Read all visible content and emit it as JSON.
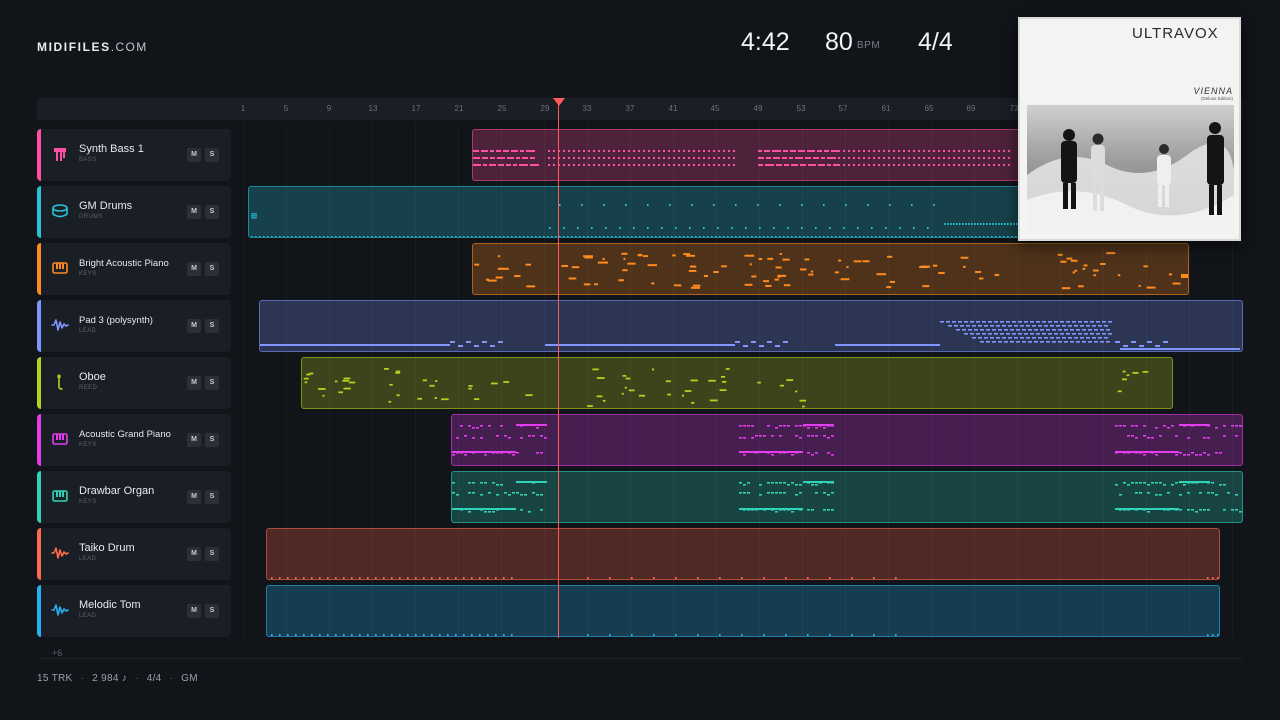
{
  "brand": {
    "name": "MIDIFILES",
    "domain": ".COM"
  },
  "stats": {
    "time": "4:42",
    "bpm": "80",
    "bpm_unit": "BPM",
    "time_signature": "4/4"
  },
  "cover": {
    "band": "ULTRAVOX",
    "album": "VIENNA",
    "edition": "(Deluxe Edition)"
  },
  "ruler": {
    "bars": [
      "1",
      "5",
      "9",
      "13",
      "17",
      "21",
      "25",
      "29",
      "33",
      "37",
      "41",
      "45",
      "49",
      "53",
      "57",
      "61",
      "65",
      "69",
      "73"
    ]
  },
  "tracks": [
    {
      "name": "Synth Bass 1",
      "category": "BASS",
      "color": "#ff4fa0",
      "icon": "bass-icon",
      "mute": "M",
      "solo": "S"
    },
    {
      "name": "GM Drums",
      "category": "DRUMS",
      "color": "#27c4d9",
      "icon": "drum-icon",
      "mute": "M",
      "solo": "S"
    },
    {
      "name": "Bright Acoustic Piano",
      "category": "KEYS",
      "color": "#ff8a1e",
      "icon": "keyboard-icon",
      "mute": "M",
      "solo": "S"
    },
    {
      "name": "Pad 3 (polysynth)",
      "category": "LEAD",
      "color": "#7f97ff",
      "icon": "waveform-icon",
      "mute": "M",
      "solo": "S"
    },
    {
      "name": "Oboe",
      "category": "REED",
      "color": "#b6d11e",
      "icon": "reed-icon",
      "mute": "M",
      "solo": "S"
    },
    {
      "name": "Acoustic Grand Piano",
      "category": "KEYS",
      "color": "#e53cf0",
      "icon": "keyboard-icon",
      "mute": "M",
      "solo": "S"
    },
    {
      "name": "Drawbar Organ",
      "category": "KEYS",
      "color": "#2fd4b8",
      "icon": "keyboard-icon",
      "mute": "M",
      "solo": "S"
    },
    {
      "name": "Taiko Drum",
      "category": "LEAD",
      "color": "#ff6a4f",
      "icon": "waveform-icon",
      "mute": "M",
      "solo": "S"
    },
    {
      "name": "Melodic Tom",
      "category": "LEAD",
      "color": "#28b0f0",
      "icon": "waveform-icon",
      "mute": "M",
      "solo": "S"
    }
  ],
  "more_tracks": "+6",
  "footer": {
    "tracks": "15 TRK",
    "notes": "2 984 ♪",
    "signature": "4/4",
    "standard": "GM"
  }
}
